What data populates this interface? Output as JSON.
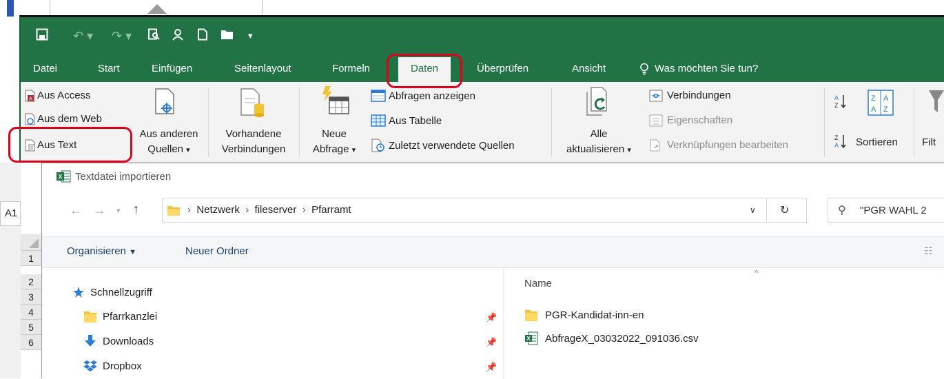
{
  "quick_access": {
    "icons": [
      "save-icon",
      "undo-icon",
      "redo-icon",
      "print-preview-icon",
      "touch-mode-icon",
      "new-document-icon",
      "open-folder-icon",
      "customize-icon"
    ]
  },
  "tabs": [
    "Datei",
    "Start",
    "Einfügen",
    "Seitenlayout",
    "Formeln",
    "Daten",
    "Überprüfen",
    "Ansicht"
  ],
  "tell_me": "Was möchten Sie tun?",
  "ribbon": {
    "external_data": {
      "aus_access": "Aus Access",
      "aus_web": "Aus dem Web",
      "aus_text": "Aus Text",
      "aus_anderen_1": "Aus anderen",
      "aus_anderen_2": "Quellen",
      "vorhandene_1": "Vorhandene",
      "vorhandene_2": "Verbindungen"
    },
    "query": {
      "neue_1": "Neue",
      "neue_2": "Abfrage",
      "abfragen_anzeigen": "Abfragen anzeigen",
      "aus_tabelle": "Aus Tabelle",
      "zuletzt": "Zuletzt verwendete Quellen"
    },
    "connections": {
      "alle_1": "Alle",
      "alle_2": "aktualisieren",
      "verbindungen": "Verbindungen",
      "eigenschaften": "Eigenschaften",
      "verknuepfungen": "Verknüpfungen bearbeiten"
    },
    "sort": {
      "sortieren": "Sortieren",
      "filter": "Filt"
    }
  },
  "namebox": "A1",
  "row_numbers": [
    "1",
    "2",
    "3",
    "4",
    "5",
    "6"
  ],
  "dialog": {
    "title": "Textdatei importieren",
    "breadcrumb": [
      "Netzwerk",
      "fileserver",
      "Pfarramt"
    ],
    "search_value": "\"PGR WAHL 2",
    "organize": "Organisieren",
    "new_folder": "Neuer Ordner",
    "column_name": "Name",
    "nav_items": [
      "Schnellzugriff",
      "Pfarrkanzlei",
      "Downloads",
      "Dropbox"
    ],
    "files": [
      "PGR-Kandidat-inn-en",
      "AbfrageX_03032022_091036.csv"
    ]
  }
}
